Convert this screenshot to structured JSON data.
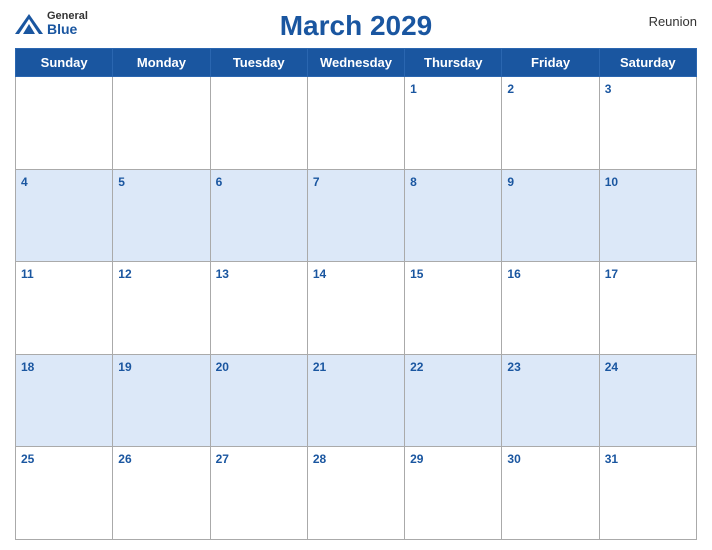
{
  "header": {
    "title": "March 2029",
    "region": "Reunion",
    "logo": {
      "general": "General",
      "blue": "Blue"
    }
  },
  "weekdays": [
    "Sunday",
    "Monday",
    "Tuesday",
    "Wednesday",
    "Thursday",
    "Friday",
    "Saturday"
  ],
  "weeks": [
    [
      {
        "day": "",
        "row": "white"
      },
      {
        "day": "",
        "row": "white"
      },
      {
        "day": "",
        "row": "white"
      },
      {
        "day": "",
        "row": "white"
      },
      {
        "day": "1",
        "row": "white"
      },
      {
        "day": "2",
        "row": "white"
      },
      {
        "day": "3",
        "row": "white"
      }
    ],
    [
      {
        "day": "4",
        "row": "blue"
      },
      {
        "day": "5",
        "row": "blue"
      },
      {
        "day": "6",
        "row": "blue"
      },
      {
        "day": "7",
        "row": "blue"
      },
      {
        "day": "8",
        "row": "blue"
      },
      {
        "day": "9",
        "row": "blue"
      },
      {
        "day": "10",
        "row": "blue"
      }
    ],
    [
      {
        "day": "11",
        "row": "white"
      },
      {
        "day": "12",
        "row": "white"
      },
      {
        "day": "13",
        "row": "white"
      },
      {
        "day": "14",
        "row": "white"
      },
      {
        "day": "15",
        "row": "white"
      },
      {
        "day": "16",
        "row": "white"
      },
      {
        "day": "17",
        "row": "white"
      }
    ],
    [
      {
        "day": "18",
        "row": "blue"
      },
      {
        "day": "19",
        "row": "blue"
      },
      {
        "day": "20",
        "row": "blue"
      },
      {
        "day": "21",
        "row": "blue"
      },
      {
        "day": "22",
        "row": "blue"
      },
      {
        "day": "23",
        "row": "blue"
      },
      {
        "day": "24",
        "row": "blue"
      }
    ],
    [
      {
        "day": "25",
        "row": "white"
      },
      {
        "day": "26",
        "row": "white"
      },
      {
        "day": "27",
        "row": "white"
      },
      {
        "day": "28",
        "row": "white"
      },
      {
        "day": "29",
        "row": "white"
      },
      {
        "day": "30",
        "row": "white"
      },
      {
        "day": "31",
        "row": "white"
      }
    ]
  ]
}
